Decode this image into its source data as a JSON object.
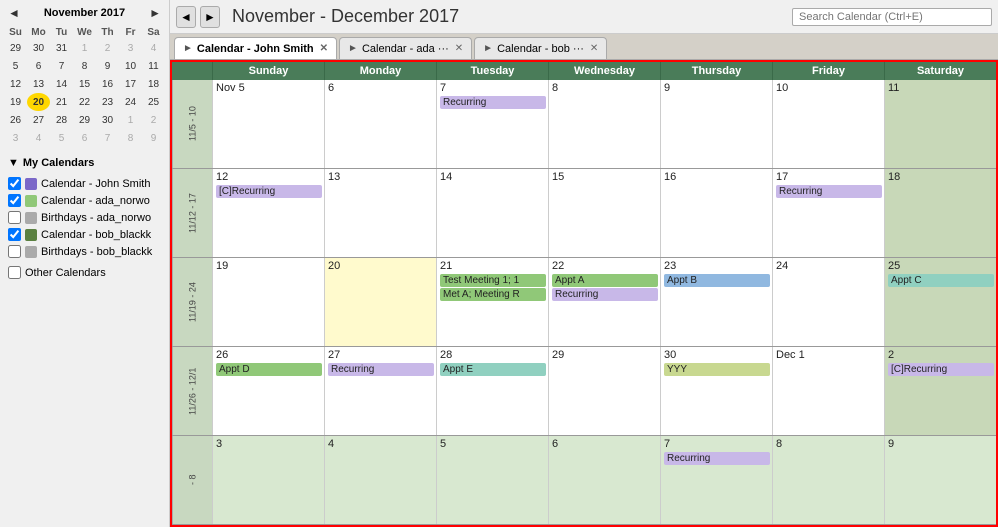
{
  "sidebar": {
    "mini_cal_title": "November 2017",
    "days_of_week": [
      "Su",
      "Mo",
      "Tu",
      "We",
      "Th",
      "Fr",
      "Sa"
    ],
    "weeks": [
      [
        "29",
        "30",
        "31",
        "1",
        "2",
        "3",
        "4"
      ],
      [
        "5",
        "6",
        "7",
        "8",
        "9",
        "10",
        "11"
      ],
      [
        "12",
        "13",
        "14",
        "15",
        "16",
        "17",
        "18"
      ],
      [
        "19",
        "20",
        "21",
        "22",
        "23",
        "24",
        "25"
      ],
      [
        "26",
        "27",
        "28",
        "29",
        "30",
        "1",
        "2"
      ],
      [
        "3",
        "4",
        "5",
        "6",
        "7",
        "8",
        "9"
      ]
    ],
    "today_date": "20",
    "my_calendars_label": "My Calendars",
    "calendars": [
      {
        "label": "Calendar - John Smith",
        "color": "#7b68c8",
        "checked": true
      },
      {
        "label": "Calendar - ada_norwo",
        "color": "#90c878",
        "checked": true
      },
      {
        "label": "Birthdays - ada_norwo",
        "color": "#aaa",
        "checked": false
      },
      {
        "label": "Calendar - bob_blackk",
        "color": "#5a8040",
        "checked": true
      },
      {
        "label": "Birthdays - bob_blackk",
        "color": "#aaa",
        "checked": false
      }
    ],
    "other_calendars_label": "Other Calendars"
  },
  "topbar": {
    "prev_label": "◄",
    "next_label": "►",
    "title": "November - December 2017",
    "search_placeholder": "Search Calendar (Ctrl+E)"
  },
  "tabs": [
    {
      "label": "Calendar - John Smith",
      "active": true,
      "close": "✕"
    },
    {
      "label": "Calendar - ada ···",
      "active": false,
      "close": "✕"
    },
    {
      "label": "Calendar - bob ···",
      "active": false,
      "close": "✕"
    }
  ],
  "calendar": {
    "day_headers": [
      "Sunday",
      "Monday",
      "Tuesday",
      "Wednesday",
      "Thursday",
      "Friday",
      "Saturday"
    ],
    "weeks": [
      {
        "label": "11/5 - 10",
        "days": [
          {
            "num": "Nov 5",
            "weekend": false,
            "events": []
          },
          {
            "num": "6",
            "weekend": false,
            "events": []
          },
          {
            "num": "7",
            "weekend": false,
            "events": [
              {
                "text": "Recurring",
                "cls": "ev-purple"
              }
            ]
          },
          {
            "num": "8",
            "weekend": false,
            "events": []
          },
          {
            "num": "9",
            "weekend": false,
            "events": []
          },
          {
            "num": "10",
            "weekend": false,
            "events": []
          },
          {
            "num": "11",
            "weekend": true,
            "events": []
          }
        ]
      },
      {
        "label": "11/12 - 17",
        "days": [
          {
            "num": "12",
            "weekend": false,
            "events": [
              {
                "text": "[C]Recurring",
                "cls": "ev-purple"
              }
            ]
          },
          {
            "num": "13",
            "weekend": false,
            "events": []
          },
          {
            "num": "14",
            "weekend": false,
            "events": []
          },
          {
            "num": "15",
            "weekend": false,
            "events": []
          },
          {
            "num": "16",
            "weekend": false,
            "events": []
          },
          {
            "num": "17",
            "weekend": false,
            "events": [
              {
                "text": "Recurring",
                "cls": "ev-purple"
              }
            ]
          },
          {
            "num": "18",
            "weekend": true,
            "events": []
          }
        ]
      },
      {
        "label": "11/19 - 24",
        "days": [
          {
            "num": "19",
            "weekend": false,
            "events": []
          },
          {
            "num": "20",
            "weekend": false,
            "today": true,
            "events": []
          },
          {
            "num": "21",
            "weekend": false,
            "events": [
              {
                "text": "Test Meeting 1; 1",
                "cls": "ev-green"
              },
              {
                "text": "Met A; Meeting R",
                "cls": "ev-green"
              }
            ]
          },
          {
            "num": "22",
            "weekend": false,
            "events": [
              {
                "text": "Appt A",
                "cls": "ev-green"
              },
              {
                "text": "Recurring",
                "cls": "ev-purple"
              }
            ]
          },
          {
            "num": "23",
            "weekend": false,
            "events": [
              {
                "text": "Appt B",
                "cls": "ev-blue"
              }
            ]
          },
          {
            "num": "24",
            "weekend": false,
            "events": []
          },
          {
            "num": "25",
            "weekend": true,
            "events": [
              {
                "text": "Appt C",
                "cls": "ev-teal"
              }
            ]
          }
        ]
      },
      {
        "label": "11/26 - 12/1",
        "days": [
          {
            "num": "26",
            "weekend": false,
            "events": [
              {
                "text": "Appt D",
                "cls": "ev-green"
              }
            ]
          },
          {
            "num": "27",
            "weekend": false,
            "events": [
              {
                "text": "Recurring",
                "cls": "ev-purple"
              }
            ]
          },
          {
            "num": "28",
            "weekend": false,
            "events": [
              {
                "text": "Appt E",
                "cls": "ev-teal"
              }
            ]
          },
          {
            "num": "29",
            "weekend": false,
            "events": []
          },
          {
            "num": "30",
            "weekend": false,
            "events": [
              {
                "text": "YYY",
                "cls": "ev-olive"
              }
            ]
          },
          {
            "num": "Dec 1",
            "weekend": false,
            "events": []
          },
          {
            "num": "2",
            "weekend": true,
            "events": [
              {
                "text": "[C]Recurring",
                "cls": "ev-purple"
              }
            ]
          }
        ]
      },
      {
        "label": "- 8",
        "days": [
          {
            "num": "3",
            "weekend": false,
            "other": true,
            "events": []
          },
          {
            "num": "4",
            "weekend": false,
            "other": true,
            "events": []
          },
          {
            "num": "5",
            "weekend": false,
            "other": true,
            "events": []
          },
          {
            "num": "6",
            "weekend": false,
            "other": true,
            "events": []
          },
          {
            "num": "7",
            "weekend": false,
            "other": true,
            "events": [
              {
                "text": "Recurring",
                "cls": "ev-purple"
              }
            ]
          },
          {
            "num": "8",
            "weekend": false,
            "other": true,
            "events": []
          },
          {
            "num": "9",
            "weekend": true,
            "other": true,
            "events": []
          }
        ]
      }
    ]
  }
}
